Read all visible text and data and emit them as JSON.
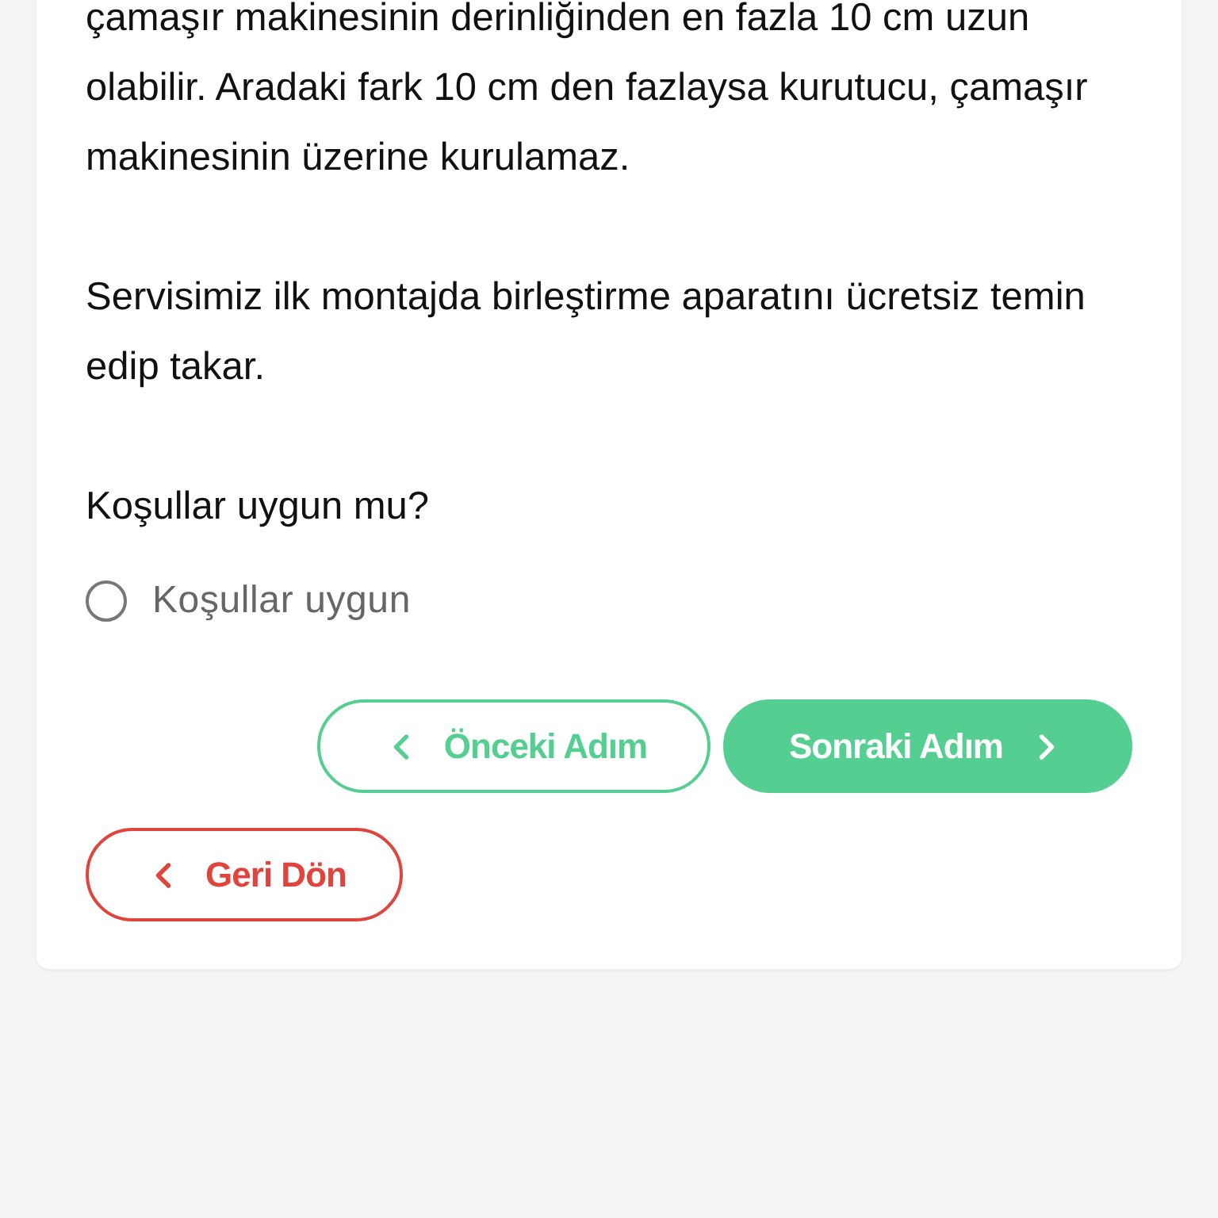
{
  "paragraphs": [
    "çamaşır makinesinin derinliğinden en fazla 10 cm uzun olabilir. Aradaki fark 10 cm den fazlaysa kurutucu, çamaşır makinesinin üzerine kurulamaz.",
    "Servisimiz ilk montajda birleştirme aparatını ücretsiz temin edip takar."
  ],
  "question": "Koşullar uygun mu?",
  "options": [
    {
      "label": "Koşullar uygun",
      "selected": false
    }
  ],
  "nav_buttons": [
    {
      "label": "Önceki Adım",
      "kind": "back"
    },
    {
      "label": "Sonraki Adım",
      "kind": "next"
    }
  ],
  "return_button": {
    "label": "Geri Dön"
  }
}
